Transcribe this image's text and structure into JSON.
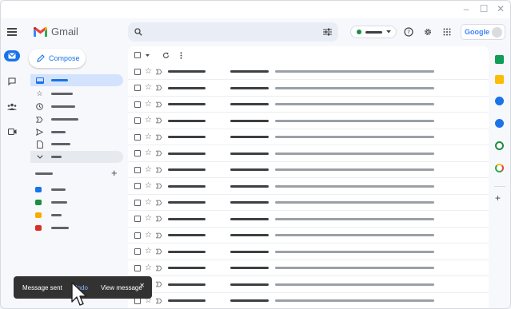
{
  "app": {
    "name": "Gmail"
  },
  "compose": {
    "label": "Compose"
  },
  "header": {
    "account_button": "Google"
  },
  "colors": {
    "accent": "#1a73e8",
    "selected_nav": "#d3e3fd",
    "status_green": "#1e8e3e",
    "snackbar_bg": "#323232",
    "undo_text": "#8ab4f8"
  },
  "icons": [
    "menu-icon",
    "mail-icon",
    "chat-icon",
    "meet-icon",
    "spaces-icon",
    "search-icon",
    "filter-icon",
    "help-icon",
    "settings-icon",
    "apps-icon",
    "inbox-icon",
    "star-icon",
    "clock-icon",
    "important-icon",
    "send-icon",
    "draft-icon",
    "chevron-down-icon",
    "plus-icon",
    "refresh-icon",
    "more-icon",
    "calendar-icon",
    "keep-icon",
    "tasks-icon",
    "contacts-icon",
    "phone-icon",
    "maps-icon",
    "close-icon",
    "cursor-icon"
  ],
  "labels": {
    "colors": [
      "#1a73e8",
      "#1e8e3e",
      "#f9ab00",
      "#d93025"
    ]
  },
  "mail_list": {
    "row_count": 15
  },
  "snackbar": {
    "message": "Message sent",
    "undo": "Undo",
    "view": "View message"
  }
}
